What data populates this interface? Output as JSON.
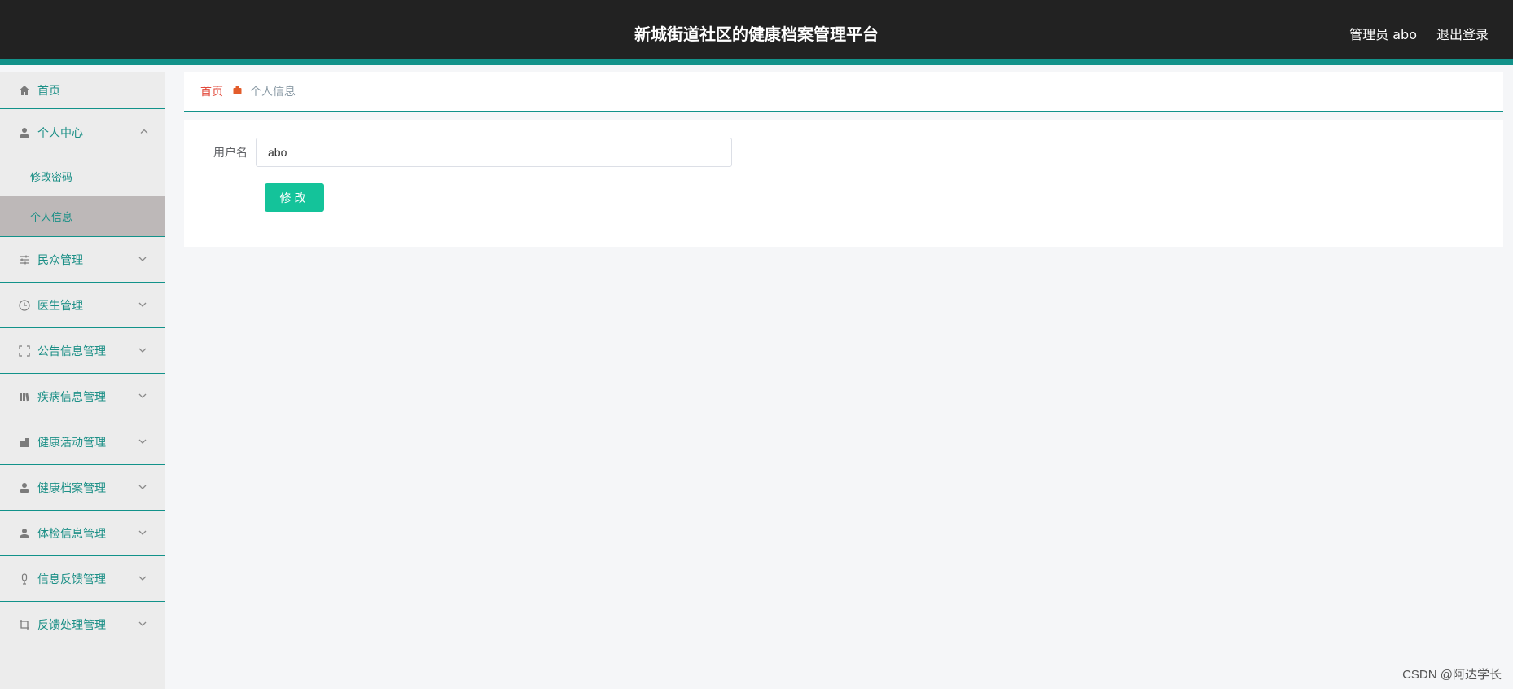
{
  "header": {
    "title": "新城街道社区的健康档案管理平台",
    "admin_label": "管理员 abo",
    "logout_label": "退出登录"
  },
  "sidebar": {
    "home": {
      "label": "首页",
      "icon": "home-icon"
    },
    "personal": {
      "label": "个人中心",
      "icon": "user-icon",
      "items": [
        {
          "label": "修改密码"
        },
        {
          "label": "个人信息"
        }
      ]
    },
    "items": [
      {
        "label": "民众管理",
        "icon": "sliders-icon"
      },
      {
        "label": "医生管理",
        "icon": "clock-icon"
      },
      {
        "label": "公告信息管理",
        "icon": "frame-icon"
      },
      {
        "label": "疾病信息管理",
        "icon": "books-icon"
      },
      {
        "label": "健康活动管理",
        "icon": "briefcase-icon"
      },
      {
        "label": "健康档案管理",
        "icon": "person-icon"
      },
      {
        "label": "体检信息管理",
        "icon": "user-filled-icon"
      },
      {
        "label": "信息反馈管理",
        "icon": "microphone-icon"
      },
      {
        "label": "反馈处理管理",
        "icon": "crop-icon"
      }
    ]
  },
  "breadcrumb": {
    "home": "首页",
    "current": "个人信息"
  },
  "form": {
    "username_label": "用户名",
    "username_value": "abo",
    "submit_label": "修改"
  },
  "watermark": "CSDN @阿达学长",
  "colors": {
    "header_bg": "#222222",
    "accent": "#12928a",
    "button": "#14c39a",
    "active_item": "#bdb8b8"
  }
}
